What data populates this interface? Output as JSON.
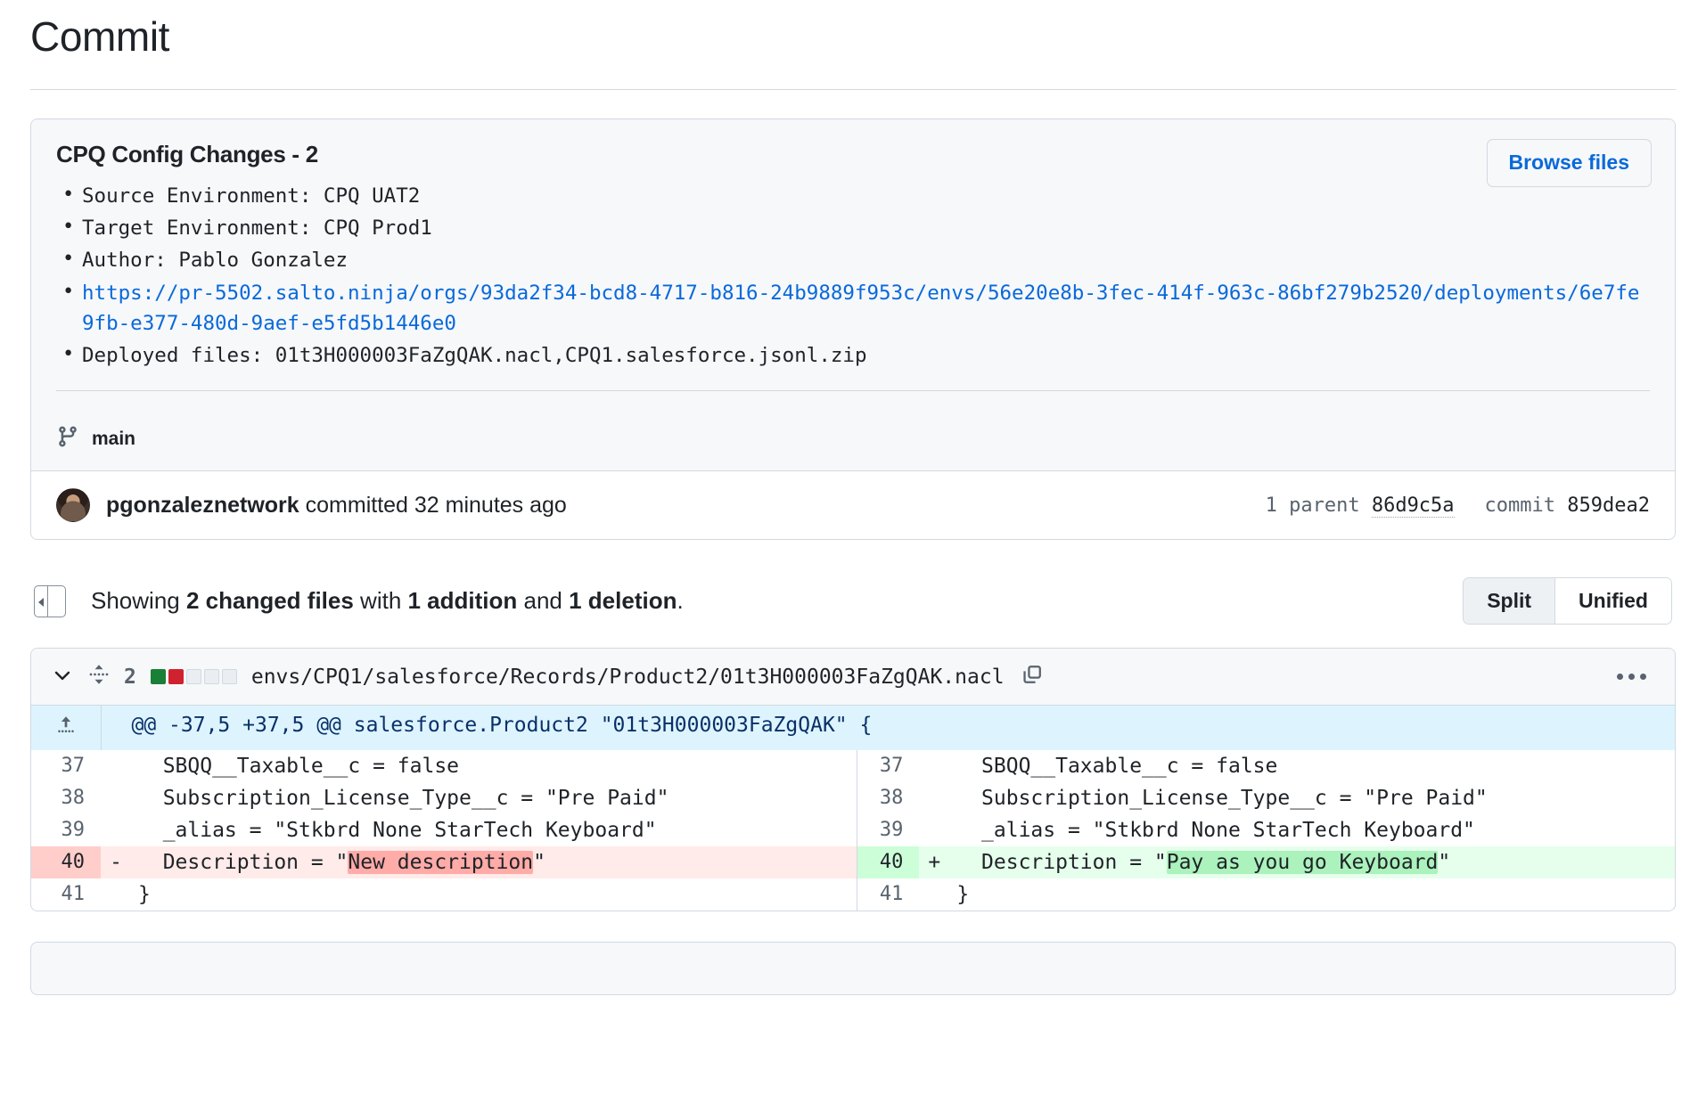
{
  "page": {
    "title": "Commit"
  },
  "commit": {
    "title": "CPQ Config Changes - 2",
    "browse_files_label": "Browse files",
    "description_lines": [
      "Source Environment: CPQ UAT2",
      "Target Environment: CPQ Prod1",
      "Author: Pablo Gonzalez",
      "Deployed files: 01t3H000003FaZgQAK.nacl,CPQ1.salesforce.jsonl.zip"
    ],
    "link_url": "https://pr-5502.salto.ninja/orgs/93da2f34-bcd8-4717-b816-24b9889f953c/envs/56e20e8b-3fec-414f-963c-86bf279b2520/deployments/6e7fe9fb-e377-480d-9aef-e5fd5b1446e0",
    "branch": "main",
    "committer": "pgonzaleznetwork",
    "committed_text": " committed 32 minutes ago",
    "parent_label": "1 parent",
    "parent_hash": "86d9c5a",
    "commit_label": "commit",
    "commit_hash": "859dea2"
  },
  "showing": {
    "prefix": "Showing ",
    "changed_files": "2 changed files",
    "mid": " with ",
    "additions": "1 addition",
    "and": " and ",
    "deletions": "1 deletion",
    "suffix": ".",
    "view_split": "Split",
    "view_unified": "Unified",
    "active_view": "Split"
  },
  "file": {
    "change_count": "2",
    "path": "envs/CPQ1/salesforce/Records/Product2/01t3H000003FaZgQAK.nacl",
    "diffstat": [
      "add",
      "del",
      "neutral",
      "neutral",
      "neutral"
    ],
    "hunk_header": "@@ -37,5 +37,5 @@ salesforce.Product2 \"01t3H000003FaZgQAK\" {",
    "rows": [
      {
        "type": "context",
        "left_ln": "37",
        "left_mark": "",
        "left_code": "  SBQQ__Taxable__c = false",
        "right_ln": "37",
        "right_mark": "",
        "right_code": "  SBQQ__Taxable__c = false"
      },
      {
        "type": "context",
        "left_ln": "38",
        "left_mark": "",
        "left_code": "  Subscription_License_Type__c = \"Pre Paid\"",
        "right_ln": "38",
        "right_mark": "",
        "right_code": "  Subscription_License_Type__c = \"Pre Paid\""
      },
      {
        "type": "context",
        "left_ln": "39",
        "left_mark": "",
        "left_code": "  _alias = \"Stkbrd None StarTech Keyboard\"",
        "right_ln": "39",
        "right_mark": "",
        "right_code": "  _alias = \"Stkbrd None StarTech Keyboard\""
      },
      {
        "type": "change",
        "left_ln": "40",
        "left_mark": "-",
        "left_code_pre": "  Description = \"",
        "left_code_hl": "New description",
        "left_code_post": "\"",
        "right_ln": "40",
        "right_mark": "+",
        "right_code_pre": "  Description = \"",
        "right_code_hl": "Pay as you go Keyboard",
        "right_code_post": "\""
      },
      {
        "type": "context",
        "left_ln": "41",
        "left_mark": "",
        "left_code": "}",
        "right_ln": "41",
        "right_mark": "",
        "right_code": "}"
      }
    ]
  },
  "colors": {
    "link": "#0969da",
    "addition": "#1a7f37",
    "deletion": "#cf222e",
    "border": "#d1d9e0",
    "surface": "#f6f8fa"
  }
}
